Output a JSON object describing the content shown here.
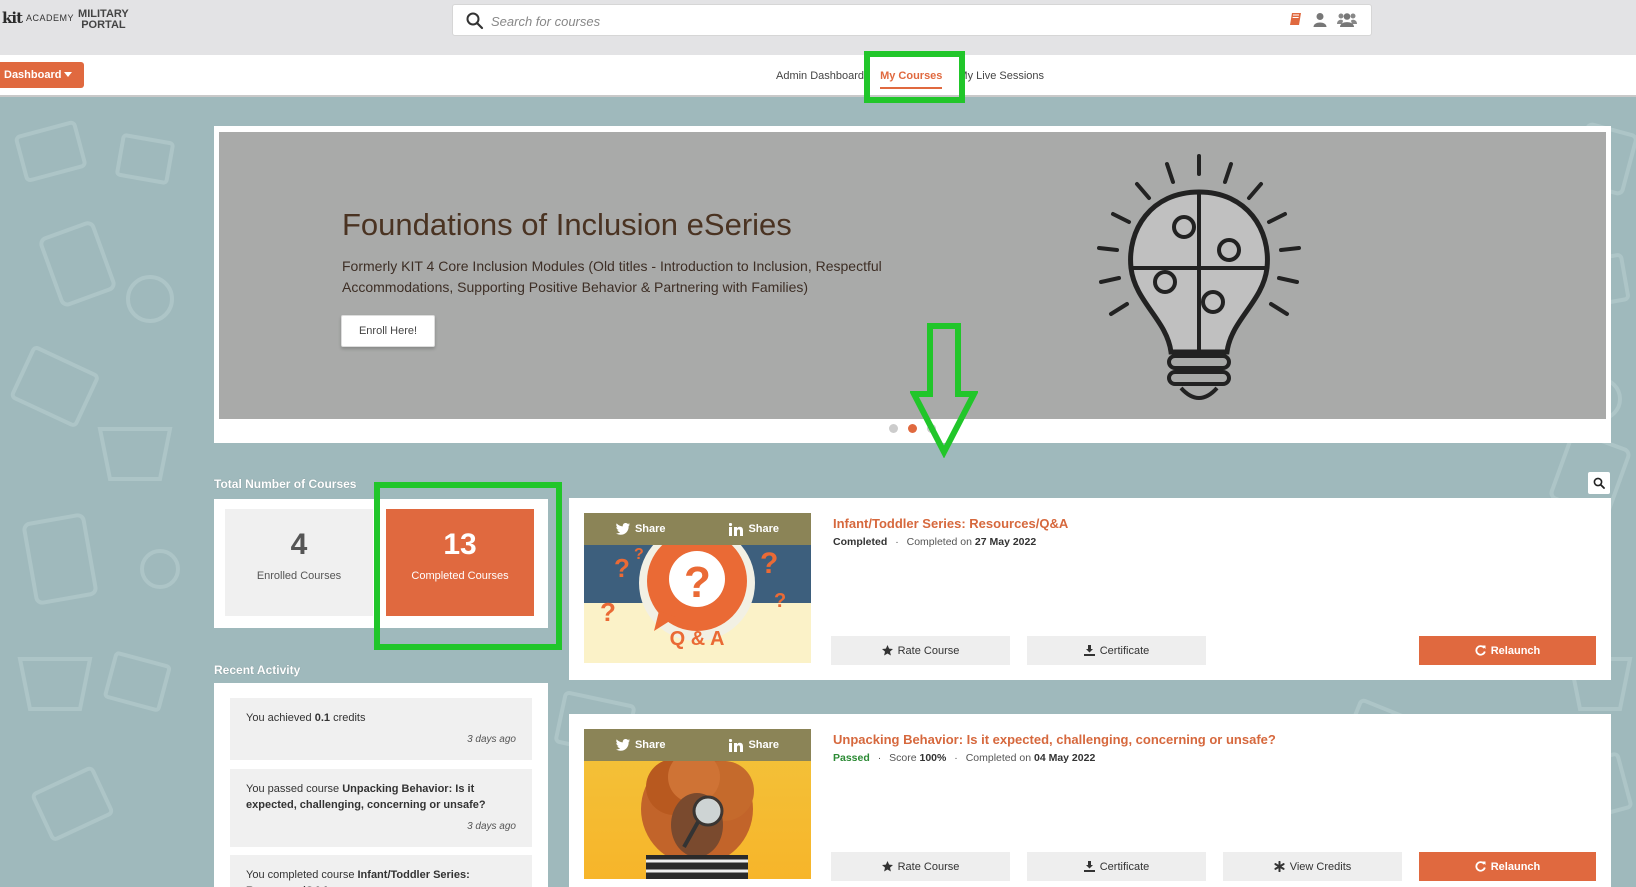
{
  "header": {
    "logo_kit": "kit",
    "logo_academy": "ACADEMY",
    "logo_military": "MILITARY",
    "logo_portal": "PORTAL",
    "search_placeholder": "Search for courses"
  },
  "nav": {
    "dashboard_label": "Dashboard",
    "links": [
      "Admin Dashboard",
      "My Courses",
      "My Live Sessions"
    ],
    "active": "My Courses"
  },
  "banner": {
    "title": "Foundations of Inclusion eSeries",
    "description": "Formerly KIT 4 Core Inclusion Modules (Old titles - Introduction to Inclusion, Respectful Accommodations, Supporting Positive Behavior & Partnering with Families)",
    "button": "Enroll Here!",
    "slide_count": 3,
    "active_slide": 2
  },
  "stats": {
    "title": "Total Number of Courses",
    "enrolled_count": "4",
    "enrolled_label": "Enrolled Courses",
    "completed_count": "13",
    "completed_label": "Completed Courses"
  },
  "activity": {
    "title": "Recent Activity",
    "items": [
      {
        "pre": "You achieved ",
        "bold": "0.1",
        "post": " credits",
        "time": "3 days ago"
      },
      {
        "pre": "You passed course ",
        "bold": "Unpacking Behavior: Is it expected, challenging, concerning or unsafe?",
        "post": "",
        "time": "3 days ago"
      },
      {
        "pre": "You completed course ",
        "bold": "Infant/Toddler Series: Resources/Q&A",
        "post": "",
        "time": ""
      }
    ]
  },
  "courses": [
    {
      "title": "Infant/Toddler Series: Resources/Q&A",
      "status": "Completed",
      "completed_prefix": "Completed on ",
      "completed_date": "27 May 2022",
      "thumb_text": "Q & A",
      "share_twitter": "Share",
      "share_linkedin": "Share",
      "rate_label": "Rate Course",
      "certificate_label": "Certificate",
      "relaunch_label": "Relaunch"
    },
    {
      "title": "Unpacking Behavior: Is it expected, challenging, concerning or unsafe?",
      "status": "Passed",
      "score_prefix": "Score ",
      "score": "100%",
      "completed_prefix": "Completed on ",
      "completed_date": "04 May 2022",
      "share_twitter": "Share",
      "share_linkedin": "Share",
      "rate_label": "Rate Course",
      "certificate_label": "Certificate",
      "credits_label": "View Credits",
      "relaunch_label": "Relaunch"
    }
  ],
  "colors": {
    "accent": "#e0693f",
    "highlight": "#21c62a",
    "background": "#9fb9bc"
  }
}
